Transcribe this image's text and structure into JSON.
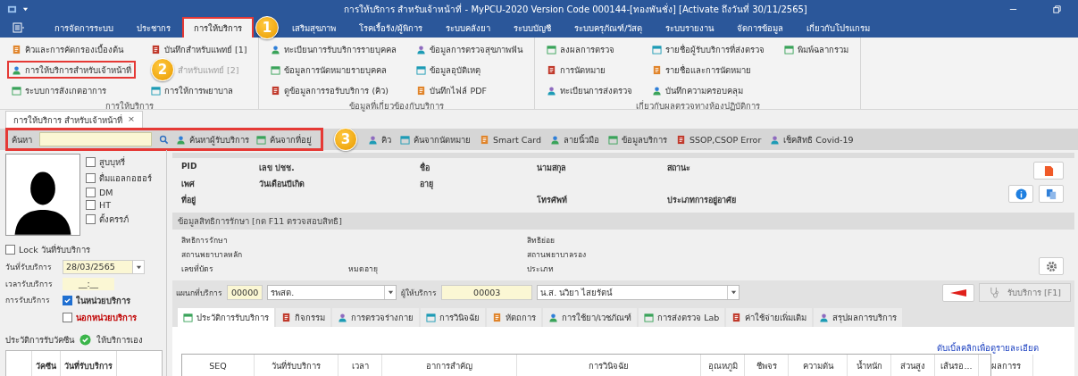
{
  "title_bar": {
    "title": "การให้บริการ สำหรับเจ้าหน้าที่ - MyPCU-2020 Version Code 000144-[ทองพันชั่ง] [Activate ถึงวันที่ 30/11/2565]"
  },
  "ribbon_tabs": [
    {
      "kind": "tab",
      "label": "การจัดการระบบ",
      "selected": false,
      "highlighted": false
    },
    {
      "kind": "tab",
      "label": "ประชากร",
      "selected": false,
      "highlighted": false
    },
    {
      "kind": "tab",
      "label": "การให้บริการ",
      "selected": true,
      "highlighted": true
    },
    {
      "kind": "callout",
      "label": "1"
    },
    {
      "kind": "tab",
      "label": "เสริมสุขภาพ",
      "selected": false,
      "highlighted": false
    },
    {
      "kind": "tab",
      "label": "โรคเรื้อรัง/ผู้พิการ",
      "selected": false,
      "highlighted": false
    },
    {
      "kind": "tab",
      "label": "ระบบคลังยา",
      "selected": false,
      "highlighted": false
    },
    {
      "kind": "tab",
      "label": "ระบบบัญชี",
      "selected": false,
      "highlighted": false
    },
    {
      "kind": "tab",
      "label": "ระบบครุภัณฑ์/วัสดุ",
      "selected": false,
      "highlighted": false
    },
    {
      "kind": "tab",
      "label": "ระบบรายงาน",
      "selected": false,
      "highlighted": false
    },
    {
      "kind": "tab",
      "label": "จัดการข้อมูล",
      "selected": false,
      "highlighted": false
    },
    {
      "kind": "tab",
      "label": "เกี่ยวกับโปรแกรม",
      "selected": false,
      "highlighted": false
    }
  ],
  "ribbon_groups": [
    {
      "title": "การให้บริการ",
      "columns": [
        [
          {
            "label": "คิวและการคัดกรองเบื้องต้น",
            "highlighted": false,
            "disabled": false
          },
          {
            "label": "การให้บริการสำหรับเจ้าหน้าที่",
            "highlighted": true,
            "disabled": false
          },
          {
            "label": "ระบบการสังเกตอาการ",
            "highlighted": false,
            "disabled": false
          }
        ],
        [
          {
            "label": "บันทึกสำหรับแพทย์ [1]",
            "highlighted": false,
            "disabled": false
          },
          {
            "label": "สำหรับแพทย์ [2]",
            "highlighted": false,
            "disabled": true,
            "callout": "2"
          },
          {
            "label": "การให้การพยาบาล",
            "highlighted": false,
            "disabled": false
          }
        ]
      ]
    },
    {
      "title": "ข้อมูลที่เกี่ยวข้องกับบริการ",
      "columns": [
        [
          {
            "label": "ทะเบียนการรับบริการรายบุคคล",
            "highlighted": false,
            "disabled": false
          },
          {
            "label": "ข้อมูลการนัดหมายรายบุคคล",
            "highlighted": false,
            "disabled": false
          },
          {
            "label": "ดูข้อมูลการรอรับบริการ (คิว)",
            "highlighted": false,
            "disabled": false
          }
        ],
        [
          {
            "label": "ข้อมูลการตรวจสุขภาพฟัน",
            "highlighted": false,
            "disabled": false
          },
          {
            "label": "ข้อมูลอุบัติเหตุ",
            "highlighted": false,
            "disabled": false
          },
          {
            "label": "บันทึกไฟล์ PDF",
            "highlighted": false,
            "disabled": false
          }
        ]
      ]
    },
    {
      "title": "เกี่ยวกับผลตรวจทางห้องปฏิบัติการ",
      "columns": [
        [
          {
            "label": "ลงผลการตรวจ",
            "highlighted": false,
            "disabled": false
          },
          {
            "label": "การนัดหมาย",
            "highlighted": false,
            "disabled": false
          },
          {
            "label": "ทะเบียนการส่งตรวจ",
            "highlighted": false,
            "disabled": false
          }
        ],
        [
          {
            "label": "รายชื่อผู้รับบริการที่ส่งตรวจ",
            "highlighted": false,
            "disabled": false
          },
          {
            "label": "รายชื่อและการนัดหมาย",
            "highlighted": false,
            "disabled": false
          },
          {
            "label": "บันทึกความครอบคลุม",
            "highlighted": false,
            "disabled": false
          }
        ],
        [
          {
            "label": "พิมพ์ฉลากรวม",
            "highlighted": false,
            "disabled": false
          }
        ]
      ]
    }
  ],
  "doc_tab": {
    "label": "การให้บริการ สำหรับเจ้าหน้าที่",
    "close": "×"
  },
  "toolbar": {
    "highlighted": true,
    "search_label": "ค้นหา",
    "search_buttons": [
      "ค้นหาผู้รับบริการ",
      "ค้นจากที่อยู่"
    ],
    "callout": "3",
    "buttons": [
      "คิว",
      "ค้นจากนัดหมาย",
      "Smart Card",
      "ลายนิ้วมือ",
      "ข้อมูลบริการ",
      "SSOP,CSOP Error",
      "เช็คสิทธิ Covid-19"
    ]
  },
  "left_panel": {
    "risk_checks": [
      {
        "label": "สูบบุหรี่",
        "checked": false
      },
      {
        "label": "ดื่มแอลกอฮอร์",
        "checked": false
      },
      {
        "label": "DM",
        "checked": false
      },
      {
        "label": "HT",
        "checked": false
      },
      {
        "label": "ตั้งครรภ์",
        "checked": false
      }
    ],
    "lock": {
      "label": "Lock วันที่รับบริการ",
      "checked": false
    },
    "date": {
      "label": "วันที่รับบริการ",
      "value": "28/03/2565"
    },
    "time": {
      "label": "เวลารับบริการ",
      "value": "__:__"
    },
    "service_place": {
      "label": "การรับบริการ",
      "options": [
        {
          "label": "ในหน่วยบริการ",
          "checked": true,
          "color": "#333333"
        },
        {
          "label": "นอกหน่วยบริการ",
          "checked": false,
          "color": "#c00000"
        }
      ]
    },
    "vaccine": {
      "label": "ประวัติการรับวัคซีน",
      "ok": true,
      "status": "ให้บริการเอง",
      "columns": [
        "วัคซีน",
        "วันที่รับบริการ"
      ]
    }
  },
  "patient_info": {
    "rows": [
      [
        "PID",
        "เลข ปชช.",
        "ชื่อ",
        "นามสกุล",
        "สถานะ"
      ],
      [
        "เพศ",
        "วันเดือนปีเกิด",
        "อายุ",
        null,
        null
      ],
      [
        "ที่อยู่",
        null,
        null,
        "โทรศัพท์",
        "ประเภทการอยู่อาศัย"
      ]
    ]
  },
  "rights": {
    "header": "ข้อมูลสิทธิการรักษา [กด F11 ตรวจสอบสิทธิ]",
    "rows": [
      [
        "สิทธิการรักษา",
        null,
        "สิทธิย่อย"
      ],
      [
        "สถานพยาบาลหลัก",
        null,
        "สถานพยาบาลรอง"
      ],
      [
        "เลขที่บัตร",
        "หมดอายุ",
        "ประเภท"
      ]
    ]
  },
  "service": {
    "dept_label": "แผนกที่บริการ",
    "dept_code": "00000",
    "dept_name": "รพสต.",
    "provider_label": "ผู้ให้บริการ",
    "provider_code": "00003",
    "provider_name": "น.ส. นวิยา ไสยรัตน์",
    "receive_button": "รับบริการ [F1]"
  },
  "tabs": [
    {
      "label": "ประวัติการรับบริการ",
      "selected": true
    },
    {
      "label": "กิจกรรม",
      "selected": false
    },
    {
      "label": "การตรวจร่างกาย",
      "selected": false
    },
    {
      "label": "การวินิจฉัย",
      "selected": false
    },
    {
      "label": "หัตถการ",
      "selected": false
    },
    {
      "label": "การใช้ยา/เวชภัณฑ์",
      "selected": false
    },
    {
      "label": "การส่งตรวจ Lab",
      "selected": false
    },
    {
      "label": "ค่าใช้จ่ายเพิ่มเติม",
      "selected": false
    },
    {
      "label": "สรุปผลการบริการ",
      "selected": false
    }
  ],
  "history": {
    "hint_link": "ดับเบิ้ลคลิกเพื่อดูรายละเอียด",
    "columns": [
      "SEQ",
      "วันที่รับบริการ",
      "เวลา",
      "อาการสำคัญ",
      "การวินิจฉัย",
      "อุณหภูมิ",
      "ชีพจร",
      "ความดัน",
      "น้ำหนัก",
      "ส่วนสูง",
      "เส้นรอ...",
      "ผลการร"
    ]
  }
}
